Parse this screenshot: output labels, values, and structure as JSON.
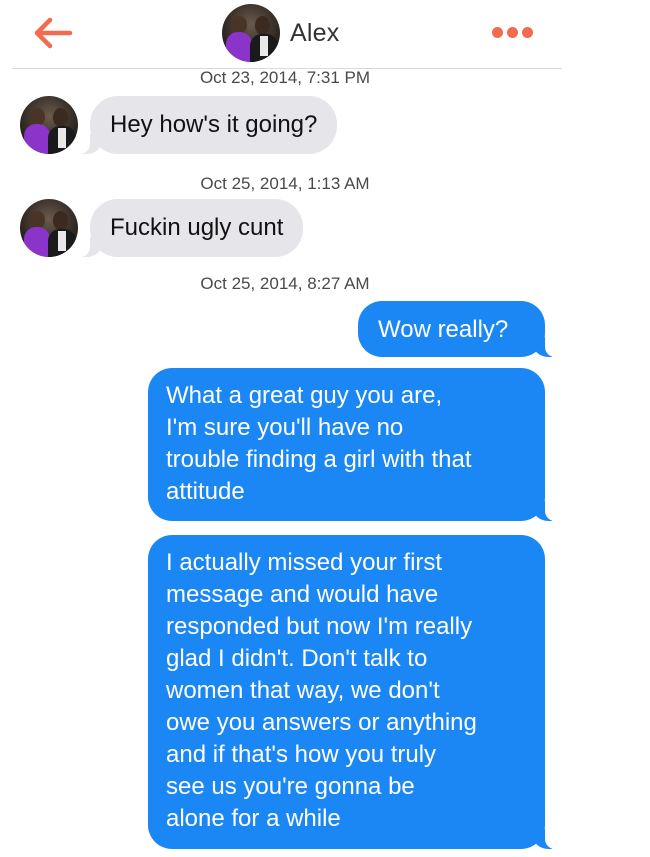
{
  "header": {
    "back_icon": "arrow-left-icon",
    "contact_name": "Alex",
    "more_icon": "more-dots-icon",
    "accent_color": "#f26a4f"
  },
  "conversation": {
    "timestamps": [
      "Oct 23, 2014, 7:31 PM",
      "Oct 25, 2014, 1:13 AM",
      "Oct 25, 2014, 8:27 AM"
    ],
    "incoming": [
      {
        "sender": "Alex",
        "text": "Hey how's it going?"
      },
      {
        "sender": "Alex",
        "text": "Fuckin ugly cunt"
      }
    ],
    "outgoing": [
      {
        "lines": [
          "Wow really?"
        ]
      },
      {
        "lines": [
          "What a great guy you are,",
          "I'm sure you'll have no",
          "trouble finding a girl with that",
          "attitude"
        ]
      },
      {
        "lines": [
          "I actually missed your first",
          "message and would have",
          "responded but now I'm really",
          "glad I didn't. Don't talk to",
          "women that way, we don't",
          "owe you answers or anything",
          "and if that's how you truly",
          "see us you're gonna be",
          "alone for a while"
        ]
      }
    ]
  },
  "colors": {
    "incoming_bubble": "#e5e5ea",
    "outgoing_bubble": "#1b87f5",
    "outgoing_text": "#ffffff"
  }
}
